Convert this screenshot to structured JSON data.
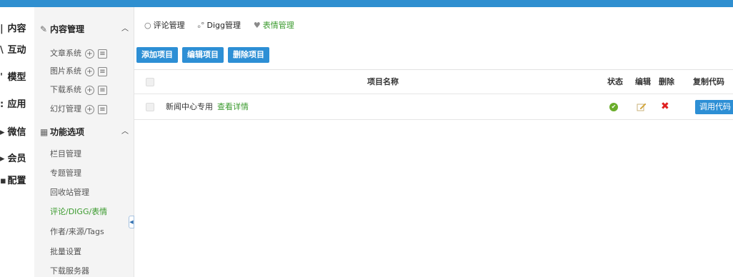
{
  "colors": {
    "accent": "#2d8fd5",
    "active": "#3a9a2d",
    "ok": "#6aad2a",
    "delete": "#e02020"
  },
  "modules": [
    {
      "icon": "content-icon",
      "glyph": "|",
      "label": "内容"
    },
    {
      "icon": "interact-icon",
      "glyph": "\\",
      "label": "互动"
    },
    {
      "icon": "model-icon",
      "glyph": "'",
      "label": "模型"
    },
    {
      "icon": "app-icon",
      "glyph": ":",
      "label": "应用"
    },
    {
      "icon": "wechat-icon",
      "glyph": "▸",
      "label": "微信"
    },
    {
      "icon": "member-icon",
      "glyph": "▸",
      "label": "会员"
    },
    {
      "icon": "config-icon",
      "glyph": "▪",
      "label": "配置"
    }
  ],
  "submenu": {
    "content_section": {
      "title": "内容管理",
      "icon": "pen-icon"
    },
    "content_items": [
      {
        "label": "文章系统"
      },
      {
        "label": "图片系统"
      },
      {
        "label": "下载系统"
      },
      {
        "label": "幻灯管理"
      }
    ],
    "function_section": {
      "title": "功能选项",
      "icon": "grid-icon"
    },
    "function_items": [
      {
        "label": "栏目管理"
      },
      {
        "label": "专题管理"
      },
      {
        "label": "回收站管理"
      },
      {
        "label": "评论/DIGG/表情",
        "active": true
      },
      {
        "label": "作者/来源/Tags"
      },
      {
        "label": "批量设置"
      },
      {
        "label": "下载服务器"
      }
    ]
  },
  "tabs": [
    {
      "label": "评论管理",
      "icon": "comment-icon",
      "glyph": "○"
    },
    {
      "label": "Digg管理",
      "icon": "digg-icon",
      "glyph": "ₒ°"
    },
    {
      "label": "表情管理",
      "icon": "heart-icon",
      "glyph": "♥",
      "active": true
    }
  ],
  "buttons": {
    "add": "添加项目",
    "edit": "编辑项目",
    "delete": "删除项目"
  },
  "table": {
    "headers": {
      "name": "项目名称",
      "status": "状态",
      "edit": "编辑",
      "delete": "删除",
      "copy": "复制代码"
    },
    "rows": [
      {
        "name": "新闻中心专用",
        "detail": "查看详情",
        "status": "enabled",
        "copy": "调用代码"
      }
    ]
  }
}
